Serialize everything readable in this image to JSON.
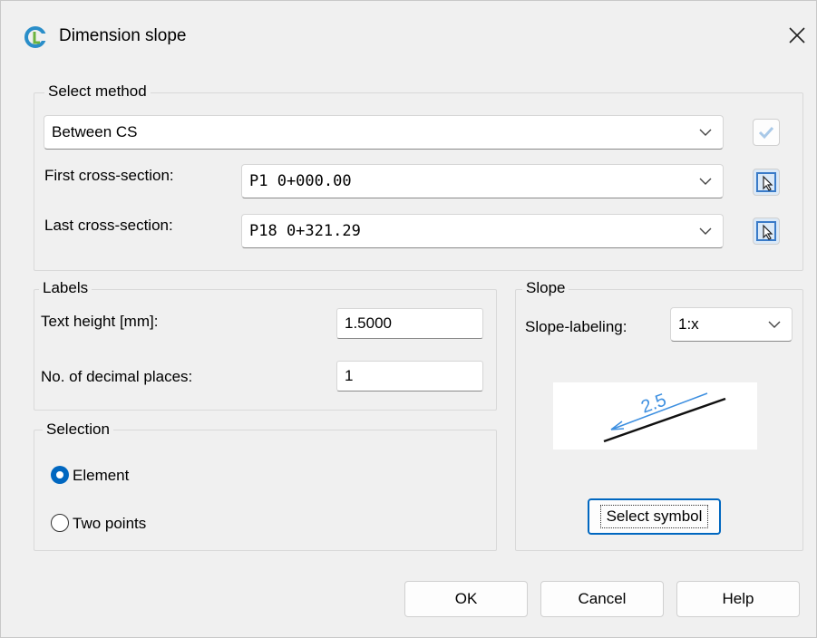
{
  "window": {
    "title": "Dimension slope",
    "close_glyph": "✕"
  },
  "select_method": {
    "legend": "Select method",
    "method_value": "Between CS",
    "first_label": "First cross-section:",
    "first_value": "P1 0+000.00",
    "last_label": "Last cross-section:",
    "last_value": "P18 0+321.29"
  },
  "labels": {
    "legend": "Labels",
    "text_height_label": "Text height [mm]:",
    "text_height_value": "1.5000",
    "decimals_label": "No. of decimal places:",
    "decimals_value": "1"
  },
  "selection": {
    "legend": "Selection",
    "options": [
      "Element",
      "Two points"
    ],
    "selected": "Element"
  },
  "slope": {
    "legend": "Slope",
    "labeling_label": "Slope-labeling:",
    "labeling_value": "1:x",
    "preview_text": "2.5",
    "select_symbol_label": "Select symbol"
  },
  "footer": {
    "ok": "OK",
    "cancel": "Cancel",
    "help": "Help"
  },
  "colors": {
    "accent": "#0067c0",
    "preview_blue": "#3d8fe0"
  }
}
